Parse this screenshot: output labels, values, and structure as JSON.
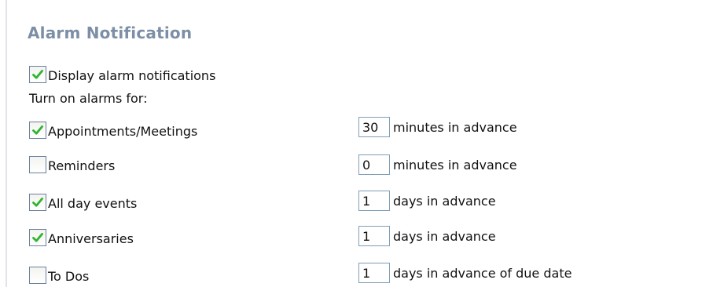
{
  "section": {
    "title": "Alarm Notification"
  },
  "display_alarms": {
    "label": "Display alarm notifications",
    "checked": true
  },
  "turn_on_label": "Turn on alarms for:",
  "alarms": [
    {
      "label": "Appointments/Meetings",
      "checked": true,
      "value": "30",
      "unit": "minutes in advance"
    },
    {
      "label": "Reminders",
      "checked": false,
      "value": "0",
      "unit": "minutes in advance"
    },
    {
      "label": "All day events",
      "checked": true,
      "value": "1",
      "unit": "days in advance"
    },
    {
      "label": "Anniversaries",
      "checked": true,
      "value": "1",
      "unit": "days in advance"
    },
    {
      "label": "To Dos",
      "checked": false,
      "value": "1",
      "unit": "days in advance of due date"
    }
  ],
  "colors": {
    "title": "#7d8fa6",
    "check": "#2fb52f",
    "checkbox_border": "#6b7f9c",
    "input_border": "#7f9db9"
  }
}
